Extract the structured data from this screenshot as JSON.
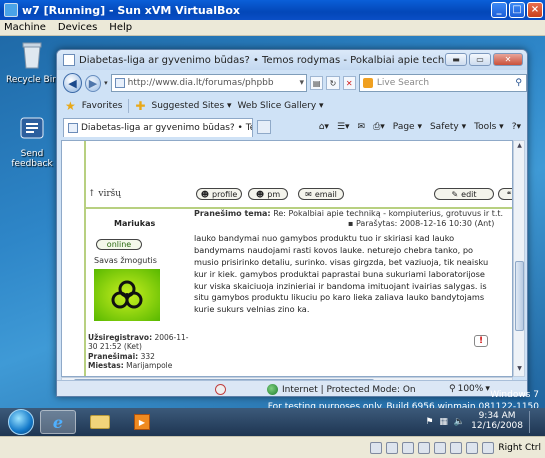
{
  "host": {
    "title": "w7 [Running] - Sun xVM VirtualBox",
    "menu": [
      "Machine",
      "Devices",
      "Help"
    ],
    "host_key": "Right Ctrl"
  },
  "desktop": {
    "icons": [
      {
        "label": "Recycle Bin",
        "icon": "recycle-bin-icon"
      },
      {
        "label": "Send feedback",
        "icon": "feedback-icon"
      }
    ],
    "watermark_line1": "Windows 7",
    "watermark_line2": "For testing purposes only. Build 6956.winmain.081122-1150"
  },
  "ie": {
    "title": "Diabetas-liga ar gyvenimo būdas? • Temos rodymas - Pokalbiai apie techniką - kompiuterius, grot - Wind...",
    "address": "http://www.dia.lt/forumas/phpbb",
    "search_placeholder": "Live Search",
    "favorites_label": "Favorites",
    "suggested_sites": "Suggested Sites ▾",
    "web_slice": "Web Slice Gallery ▾",
    "tab_title": "Diabetas-liga ar gyvenimo būdas? • Temos rod...",
    "commands": {
      "page": "Page ▾",
      "safety": "Safety ▾",
      "tools": "Tools ▾"
    },
    "status_zone": "Internet | Protected Mode: On",
    "zoom": "100%"
  },
  "forum": {
    "top_link": "↑ viršų",
    "buttons": {
      "profile": "profile",
      "pm": "pm",
      "email": "email",
      "edit": "edit"
    },
    "author": {
      "name": "Mariukas",
      "status": "online",
      "rank": "Savas žmogutis",
      "registered_label": "Užsiregistravo:",
      "registered_value": "2006-11-30 21:52 (Ket)",
      "posts_label": "Pranešimai:",
      "posts_value": "332",
      "city_label": "Miestas:",
      "city_value": "Marijampole"
    },
    "post": {
      "subject_label": "Pranešimo tema:",
      "subject_value": "Re: Pokalbiai apie techniką - kompiuterius, grotuvus ir t.t.",
      "posted": "Parašytas: 2008-12-16 10:30 (Ant)",
      "body": "lauko bandymai nuo gamybos produktu tuo ir skiriasi kad lauko bandymams naudojami rasti kovos lauke. neturejo chebra tanko, po musio prisirinko detaliu, surinko. visas girgzda, bet vaziuoja, tik neaisku kur ir kiek. gamybos produktai paprastai buna sukuriami laboratorijose kur viska skaiciuoja inzinieriai ir bandoma imituojant ivairias salygas. is situ gamybos produktu likuciu po karo lieka zaliava lauko bandytojams kurie sukurs velnias zino ka."
    }
  },
  "taskbar": {
    "time": "9:34 AM",
    "date": "12/16/2008"
  }
}
